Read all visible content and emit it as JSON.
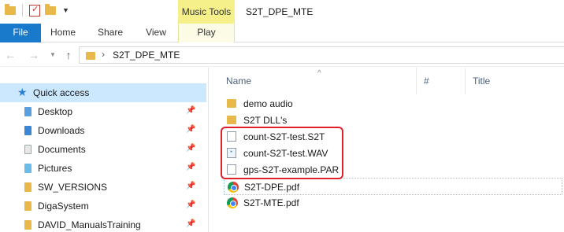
{
  "titlebar": {
    "context_tab": "Music Tools",
    "window_title": "S2T_DPE_MTE"
  },
  "ribbon": {
    "tabs": [
      {
        "label": "File"
      },
      {
        "label": "Home"
      },
      {
        "label": "Share"
      },
      {
        "label": "View"
      },
      {
        "label": "Play"
      }
    ]
  },
  "address_bar": {
    "path": "S2T_DPE_MTE"
  },
  "sidebar": {
    "quick_access": "Quick access",
    "items": [
      {
        "label": "Desktop",
        "icon": "desktop-icon",
        "pinned": true
      },
      {
        "label": "Downloads",
        "icon": "downloads-icon",
        "pinned": true
      },
      {
        "label": "Documents",
        "icon": "documents-icon",
        "pinned": true
      },
      {
        "label": "Pictures",
        "icon": "pictures-icon",
        "pinned": true
      },
      {
        "label": "SW_VERSIONS",
        "icon": "folder-icon",
        "pinned": true
      },
      {
        "label": "DigaSystem",
        "icon": "folder-icon",
        "pinned": true
      },
      {
        "label": "DAVID_ManualsTraining",
        "icon": "folder-icon",
        "pinned": true
      }
    ]
  },
  "file_list": {
    "columns": [
      {
        "label": "Name"
      },
      {
        "label": "#"
      },
      {
        "label": "Title"
      }
    ],
    "items": [
      {
        "name": "demo audio",
        "type": "folder"
      },
      {
        "name": "S2T DLL's",
        "type": "folder"
      },
      {
        "name": "count-S2T-test.S2T",
        "type": "file"
      },
      {
        "name": "count-S2T-test.WAV",
        "type": "wav"
      },
      {
        "name": "gps-S2T-example.PAR",
        "type": "file"
      },
      {
        "name": "S2T-DPE.pdf",
        "type": "pdf"
      },
      {
        "name": "S2T-MTE.pdf",
        "type": "pdf"
      }
    ]
  },
  "colors": {
    "file_tab": "#1979ca",
    "music_tools": "#f5f08a",
    "selection": "#cce8ff",
    "highlight": "#e0202a"
  }
}
